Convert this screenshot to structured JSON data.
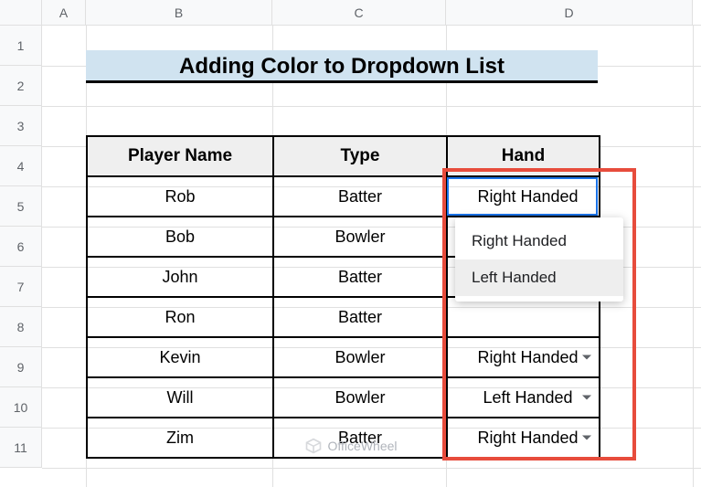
{
  "columns": [
    "A",
    "B",
    "C",
    "D"
  ],
  "rows": [
    "1",
    "2",
    "3",
    "4",
    "5",
    "6",
    "7",
    "8",
    "9",
    "10",
    "11"
  ],
  "title": "Adding Color to Dropdown List",
  "table": {
    "headers": {
      "name": "Player Name",
      "type": "Type",
      "hand": "Hand"
    },
    "rows": [
      {
        "name": "Rob",
        "type": "Batter",
        "hand": "Right Handed"
      },
      {
        "name": "Bob",
        "type": "Bowler",
        "hand": ""
      },
      {
        "name": "John",
        "type": "Batter",
        "hand": ""
      },
      {
        "name": "Ron",
        "type": "Batter",
        "hand": ""
      },
      {
        "name": "Kevin",
        "type": "Bowler",
        "hand": "Right Handed"
      },
      {
        "name": "Will",
        "type": "Bowler",
        "hand": "Left Handed"
      },
      {
        "name": "Zim",
        "type": "Batter",
        "hand": "Right Handed"
      }
    ]
  },
  "dropdown": {
    "options": [
      "Right Handed",
      "Left Handed"
    ],
    "highlighted_index": 1
  },
  "watermark": "OfficeWheel"
}
